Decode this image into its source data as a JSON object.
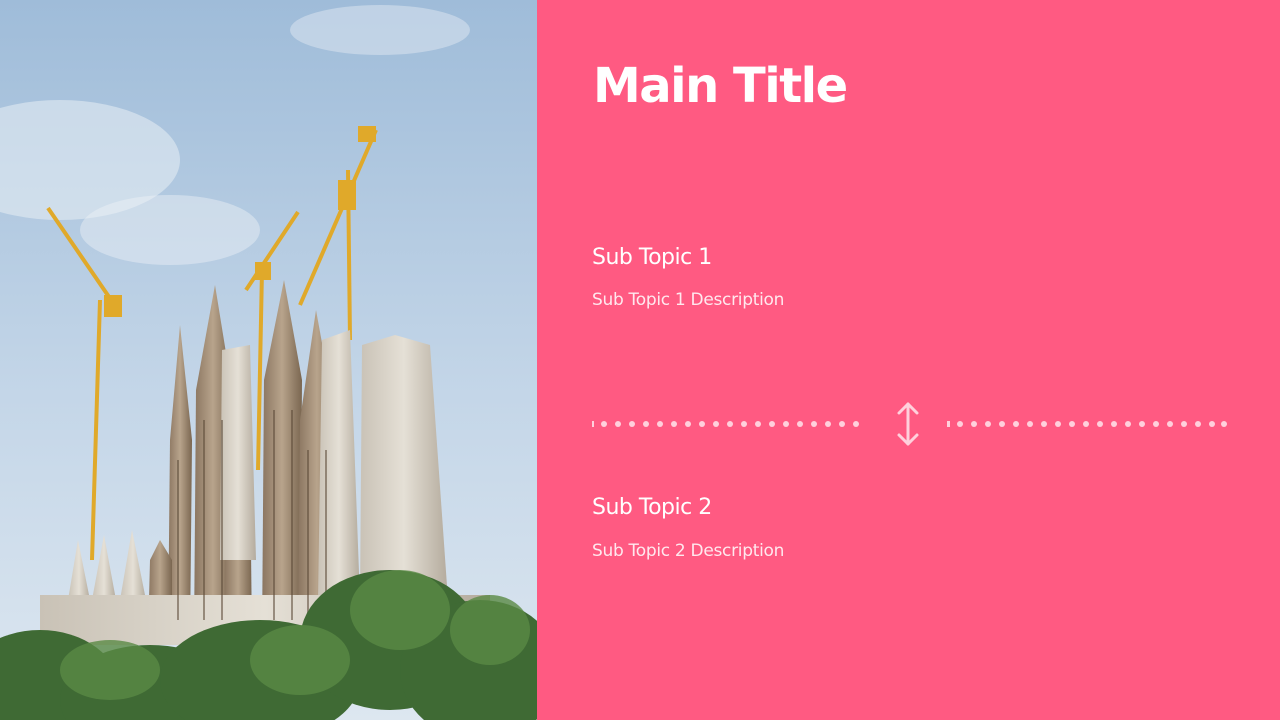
{
  "slide": {
    "title": "Main Title",
    "accent_color": "#ff5a82",
    "sections": [
      {
        "heading": "Sub Topic 1",
        "description": "Sub Topic 1 Description"
      },
      {
        "heading": "Sub Topic 2",
        "description": "Sub Topic 2 Description"
      }
    ]
  },
  "image": {
    "subject": "cathedral towers with construction cranes against blue sky",
    "divider_icon": "vertical-double-arrow-icon"
  }
}
